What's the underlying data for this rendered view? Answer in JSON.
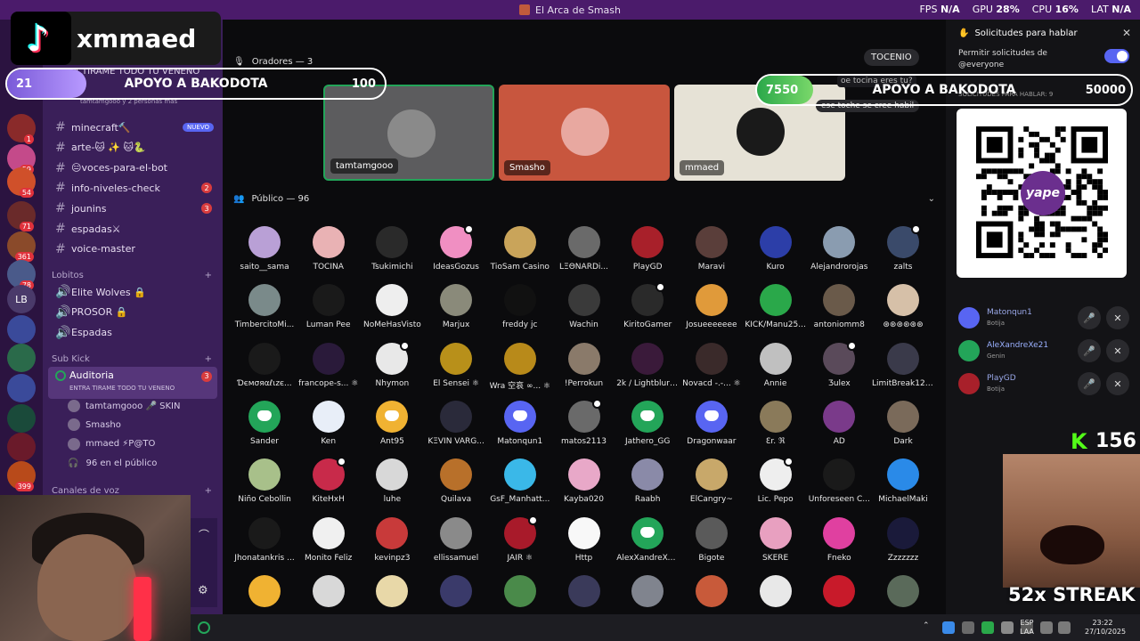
{
  "window": {
    "title": "El Arca de Smash"
  },
  "perf": [
    {
      "label": "FPS",
      "value": "N/A"
    },
    {
      "label": "GPU",
      "value": "28%"
    },
    {
      "label": "CPU",
      "value": "16%"
    },
    {
      "label": "LAT",
      "value": "N/A"
    }
  ],
  "tiktok_overlay": {
    "handle": "xmmaed"
  },
  "goals": {
    "left": {
      "count": "21",
      "label": "APOYO A BAKODOTA",
      "target": "100",
      "progress": 0.21
    },
    "right": {
      "count": "7550",
      "label": "APOYO A BAKODOTA",
      "target": "50000",
      "progress": 0.151
    }
  },
  "sidebar": {
    "server_header": "A TIRAME TODO TU VENENO",
    "header_sub": "tamtamgooo y 2 personas más",
    "channels": [
      {
        "name": "minecraft🔨",
        "badge": "NUEVO"
      },
      {
        "name": "arte-🐱 ✨ 🐱🐍",
        "badge": ""
      },
      {
        "name": "😑voces-para-el-bot",
        "badge": ""
      },
      {
        "name": "info-niveles-check",
        "badge": "2"
      },
      {
        "name": "jounins",
        "badge": "3"
      },
      {
        "name": "espadas⚔",
        "badge": ""
      },
      {
        "name": "voice-master",
        "badge": ""
      }
    ],
    "cat_lobitos": "Lobitos",
    "lobitos": [
      "Elite Wolves 🔒",
      "PROSOR 🔒",
      "Espadas"
    ],
    "cat_subkick": "Sub Kick",
    "stage_channel": {
      "name": "Auditoria",
      "topic": "ENTRA TIRAME TODO TU VENENO",
      "badge": "3"
    },
    "stage_users": [
      "tamtamgooo 🎤 SKIN",
      "Smasho",
      "mmaed ⚡P@TO"
    ],
    "audience_count": "96 en el público",
    "cat_voice": "Canales de voz"
  },
  "stage": {
    "speakers_header": "Oradores — 3",
    "speakers": [
      {
        "name": "tamtamgooo",
        "bg": "#5c5c5e"
      },
      {
        "name": "Smasho",
        "bg": "#c8563e"
      },
      {
        "name": "mmaed",
        "bg": "#e6e2d6"
      }
    ],
    "chat_user": "TOCENIO",
    "chat_lines": [
      "oe tocina eres tu?",
      "ese toche se cree habil"
    ],
    "public_header": "Público — 96"
  },
  "audience": [
    {
      "name": "saito__sama",
      "color": "#b9a0d6",
      "discord": false
    },
    {
      "name": "TOCINA",
      "color": "#e9b2b4",
      "discord": false
    },
    {
      "name": "Tsukimichi",
      "color": "#2a2a2a",
      "discord": false
    },
    {
      "name": "IdeasGozus",
      "color": "#f08fc2",
      "discord": false
    },
    {
      "name": "TioSam Casino",
      "color": "#c9a45a",
      "discord": false
    },
    {
      "name": "LΞΘNARDi...",
      "color": "#6a6a6a",
      "discord": false
    },
    {
      "name": "PlayGD",
      "color": "#a8202a",
      "discord": false
    },
    {
      "name": "Maravi",
      "color": "#5a3e3a",
      "discord": false
    },
    {
      "name": "Kuro",
      "color": "#2c3ea8",
      "discord": false
    },
    {
      "name": "Alejandrorojas",
      "color": "#8a9cb0",
      "discord": false
    },
    {
      "name": "zalts",
      "color": "#3a4a6a",
      "discord": false
    },
    {
      "name": "TimbercitoMi...",
      "color": "#7a8a8a",
      "discord": false
    },
    {
      "name": "Luman Pee",
      "color": "#1a1a1a",
      "discord": false
    },
    {
      "name": "NoMeHasVisto",
      "color": "#eeeeee",
      "discord": false
    },
    {
      "name": "Marjux",
      "color": "#8a8a7a",
      "discord": false
    },
    {
      "name": "freddy jc",
      "color": "#111111",
      "discord": false
    },
    {
      "name": "Wachin",
      "color": "#3a3a3a",
      "discord": false
    },
    {
      "name": "KiritoGamer",
      "color": "#2a2a2a",
      "discord": false
    },
    {
      "name": "Josueeeeeee",
      "color": "#e09a3a",
      "discord": false
    },
    {
      "name": "KICK/Manu25...",
      "color": "#2aa84a",
      "discord": false
    },
    {
      "name": "antoniomm8",
      "color": "#6a5a4a",
      "discord": false
    },
    {
      "name": "⊛⊛⊛⊛⊛⊛",
      "color": "#d6c0a8",
      "discord": false
    },
    {
      "name": "Ɗємσяαℓιzє...",
      "color": "#1a1a1a",
      "discord": false
    },
    {
      "name": "francope-s... ⚛",
      "color": "#2a1a3a",
      "discord": false
    },
    {
      "name": "Nhymon",
      "color": "#e8e8e8",
      "discord": false
    },
    {
      "name": "El Sensei ⚛",
      "color": "#b8901a",
      "discord": false
    },
    {
      "name": "Wra 空哀 ∞... ⚛",
      "color": "#b88a1a",
      "discord": false
    },
    {
      "name": "!Perrokun",
      "color": "#8a7a6a",
      "discord": false
    },
    {
      "name": "2k / Lightblur ⚛",
      "color": "#3a1a3a",
      "discord": false
    },
    {
      "name": "Novacd -.-... ⚛",
      "color": "#3a2a2a",
      "discord": false
    },
    {
      "name": "Annie",
      "color": "#c0c0c0",
      "discord": false
    },
    {
      "name": "Ʒulex",
      "color": "#5a4a5a",
      "discord": false
    },
    {
      "name": "LimitBreak123x",
      "color": "#3a3a4a",
      "discord": false
    },
    {
      "name": "Sander",
      "color": "#23a559",
      "discord": true
    },
    {
      "name": "Ken",
      "color": "#e8eef8",
      "discord": false
    },
    {
      "name": "Ant95",
      "color": "#f0b232",
      "discord": true
    },
    {
      "name": "KΞVIN VARG...",
      "color": "#2a2a3a",
      "discord": false
    },
    {
      "name": "Matonqun1",
      "color": "#5865f2",
      "discord": true
    },
    {
      "name": "matos2113",
      "color": "#6a6a6a",
      "discord": false
    },
    {
      "name": "Jathero_GG",
      "color": "#23a559",
      "discord": true
    },
    {
      "name": "Dragonwaar",
      "color": "#5865f2",
      "discord": true
    },
    {
      "name": "Ɛr. ℜ",
      "color": "#8a7a5a",
      "discord": false
    },
    {
      "name": "AD",
      "color": "#7a3a8a",
      "discord": false
    },
    {
      "name": "Dark",
      "color": "#7a6a5a",
      "discord": false
    },
    {
      "name": "Niño Cebollin",
      "color": "#a8c08a",
      "discord": false
    },
    {
      "name": "KiteHxH",
      "color": "#c82a4a",
      "discord": false
    },
    {
      "name": "luhe",
      "color": "#d8d8d8",
      "discord": false
    },
    {
      "name": "Quilava",
      "color": "#b8702a",
      "discord": false
    },
    {
      "name": "GsF_Manhatt...",
      "color": "#3ab8e8",
      "discord": false
    },
    {
      "name": "Kayba020",
      "color": "#e8a8c8",
      "discord": false
    },
    {
      "name": "Raabh",
      "color": "#8a8aa8",
      "discord": false
    },
    {
      "name": "ElCangry~",
      "color": "#c8a86a",
      "discord": false
    },
    {
      "name": "Lic. Pepo",
      "color": "#eeeeee",
      "discord": false
    },
    {
      "name": "Unforeseen C...",
      "color": "#1a1a1a",
      "discord": false
    },
    {
      "name": "MichaelMaki",
      "color": "#2a8ae8",
      "discord": false
    },
    {
      "name": "Jhonatankris ...",
      "color": "#1a1a1a",
      "discord": false
    },
    {
      "name": "Monito Feliz",
      "color": "#f0f0f0",
      "discord": false
    },
    {
      "name": "kevinpz3",
      "color": "#c83a3a",
      "discord": false
    },
    {
      "name": "ellissamuel",
      "color": "#8a8a8a",
      "discord": false
    },
    {
      "name": "JAIR ⚛",
      "color": "#a81a2a",
      "discord": false
    },
    {
      "name": "Http",
      "color": "#f8f8f8",
      "discord": false
    },
    {
      "name": "AlexXandreXe21",
      "color": "#23a559",
      "discord": true
    },
    {
      "name": "Bigote",
      "color": "#5a5a5a",
      "discord": false
    },
    {
      "name": "SKERE",
      "color": "#e8a0c0",
      "discord": false
    },
    {
      "name": "Fneko",
      "color": "#e040a0",
      "discord": false
    },
    {
      "name": "Zzzzzzz",
      "color": "#1a1a3a",
      "discord": false
    }
  ],
  "audience_row7_colors": [
    "#f0b232",
    "#d8d8d8",
    "#e8d8a8",
    "#3a3a6a",
    "#4a8a4a",
    "#3a3a5a",
    "#80848e",
    "#c85a3a",
    "#e8e8e8",
    "#c81a2a",
    "#5a6a5a"
  ],
  "right_panel": {
    "title": "Solicitudes para hablar",
    "permit_label": "Permitir solicitudes de @everyone",
    "section_label": "SOLICITUDES PARA HABLAR: 9",
    "requests": [
      {
        "name": "Matonqun1",
        "role": "Botija",
        "color": "#5865f2"
      },
      {
        "name": "AleXandreXe21",
        "role": "Genin",
        "color": "#23a559"
      },
      {
        "name": "PlayGD",
        "role": "Botija",
        "color": "#a8202a"
      }
    ]
  },
  "qr": {
    "brand": "yape"
  },
  "streak": {
    "kick_letter": "K",
    "count": "156",
    "label": "52x STREAK"
  },
  "taskbar": {
    "lang": "ESP\nLAA",
    "time": "23:22",
    "date": "27/10/2025"
  },
  "rail": {
    "lb_label": "LB"
  }
}
